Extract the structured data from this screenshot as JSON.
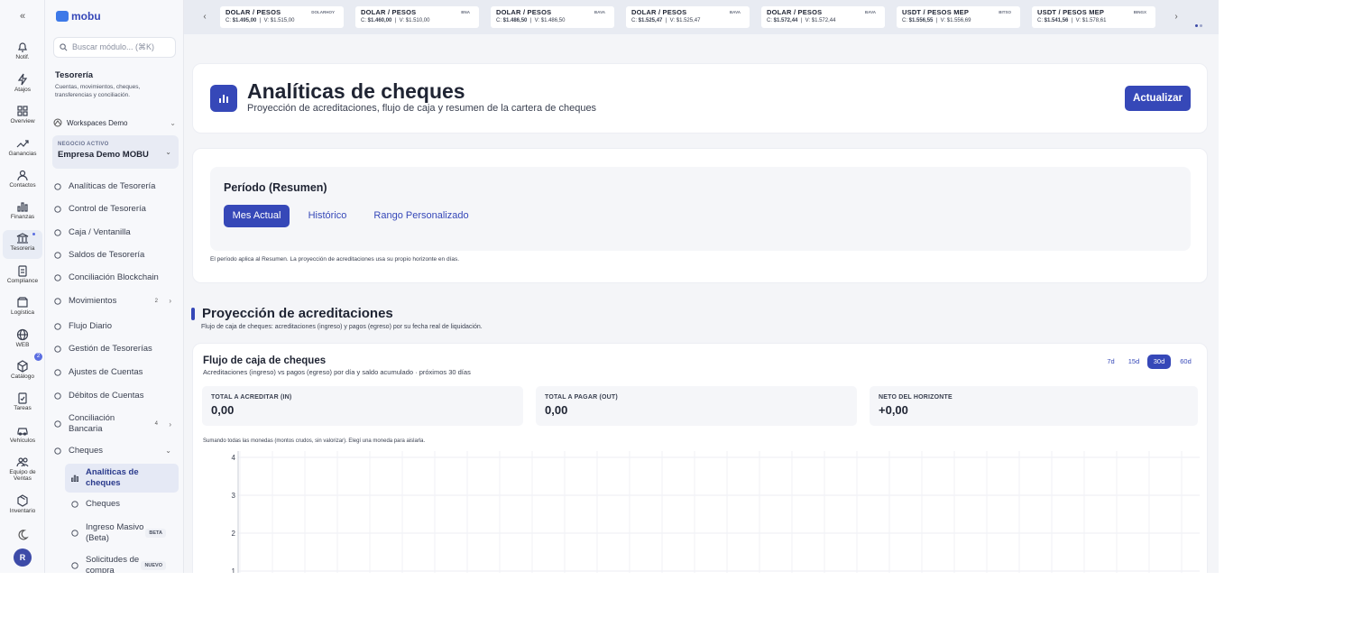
{
  "sidebar_rail": {
    "items": [
      {
        "label": "Notif.",
        "icon": "bell-icon"
      },
      {
        "label": "Atajos",
        "icon": "lightning-icon"
      },
      {
        "label": "Overview",
        "icon": "grid-icon"
      },
      {
        "label": "Ganancias",
        "icon": "trend-up-icon"
      },
      {
        "label": "Contactos",
        "icon": "users-icon"
      },
      {
        "label": "Finanzas",
        "icon": "bar-chart-icon"
      },
      {
        "label": "Tesorería",
        "icon": "bank-icon"
      },
      {
        "label": "Compliance",
        "icon": "clipboard-icon"
      },
      {
        "label": "Logística",
        "icon": "box-icon"
      },
      {
        "label": "WEB",
        "icon": "globe-icon"
      },
      {
        "label": "Catálogo",
        "icon": "cube-icon"
      },
      {
        "label": "Tareas",
        "icon": "clipboard-check-icon"
      },
      {
        "label": "Vehículos",
        "icon": "car-icon"
      },
      {
        "label": "Equipo de Ventas",
        "icon": "team-icon"
      },
      {
        "label": "Inventario",
        "icon": "package-icon"
      }
    ],
    "catalogo_badge": "2",
    "avatar_initial": "R"
  },
  "sidebar": {
    "brand": "mobu",
    "search_placeholder": "Buscar módulo... (⌘K)",
    "section_title": "Tesorería",
    "section_subtitle": "Cuentas, movimientos, cheques, transferencias y conciliación.",
    "workspace": "Workspaces Demo",
    "business_label": "NEGOCIO ACTIVO",
    "business_name": "Empresa Demo MOBU",
    "nav": [
      {
        "label": "Analíticas de Tesorería"
      },
      {
        "label": "Control de Tesorería"
      },
      {
        "label": "Caja / Ventanilla"
      },
      {
        "label": "Saldos de Tesorería"
      },
      {
        "label": "Conciliación Blockchain"
      },
      {
        "label": "Movimientos",
        "badge": "2"
      },
      {
        "label": "Flujo Diario"
      },
      {
        "label": "Gestión de Tesorerías"
      },
      {
        "label": "Ajustes de Cuentas"
      },
      {
        "label": "Débitos de Cuentas"
      },
      {
        "label": "Conciliación Bancaria",
        "badge": "4"
      },
      {
        "label": "Cheques"
      }
    ],
    "sub_nav": [
      {
        "label": "Analíticas de cheques"
      },
      {
        "label": "Cheques"
      },
      {
        "label": "Ingreso Masivo (Beta)",
        "tag": "BETA"
      },
      {
        "label": "Solicitudes de compra",
        "tag": "NUEVO"
      }
    ]
  },
  "ticker": [
    {
      "pair": "DOLAR / PESOS",
      "source": "DOLARHOY",
      "buy": "$1.495,00",
      "sell": "$1.515,00"
    },
    {
      "pair": "DOLAR / PESOS",
      "source": "BNA",
      "buy": "$1.460,00",
      "sell": "$1.510,00"
    },
    {
      "pair": "DOLAR / PESOS",
      "source": "BAVA",
      "buy": "$1.486,50",
      "sell": "$1.486,50"
    },
    {
      "pair": "DOLAR / PESOS",
      "source": "BAVA",
      "buy": "$1.525,47",
      "sell": "$1.525,47"
    },
    {
      "pair": "DOLAR / PESOS",
      "source": "BAVA",
      "buy": "$1.572,44",
      "sell": "$1.572,44"
    },
    {
      "pair": "USDT / PESOS MEP",
      "source": "BITSO",
      "buy": "$1.556,55",
      "sell": "$1.556,69"
    },
    {
      "pair": "USDT / PESOS MEP",
      "source": "BINGX",
      "buy": "$1.541,56",
      "sell": "$1.578,61"
    }
  ],
  "ticker_prefix_buy": "C:",
  "ticker_prefix_sell": "V:",
  "header": {
    "title": "Analíticas de cheques",
    "subtitle": "Proyección de acreditaciones, flujo de caja y resumen de la cartera de cheques",
    "refresh_label": "Actualizar"
  },
  "period": {
    "title": "Período (Resumen)",
    "options": [
      "Mes Actual",
      "Histórico",
      "Rango Personalizado"
    ],
    "selected": "Mes Actual",
    "note": "El período aplica al Resumen. La proyección de acreditaciones usa su propio horizonte en días."
  },
  "projection": {
    "title": "Proyección de acreditaciones",
    "subtitle": "Flujo de caja de cheques: acreditaciones (ingreso) y pagos (egreso) por su fecha real de liquidación."
  },
  "cashflow": {
    "title": "Flujo de caja de cheques",
    "subtitle": "Acreditaciones (ingreso) vs pagos (egreso) por día y saldo acumulado · próximos 30 días",
    "ranges": [
      "7d",
      "15d",
      "30d",
      "60d"
    ],
    "selected_range": "30d",
    "kpis": [
      {
        "label": "TOTAL A ACREDITAR (IN)",
        "value": "0,00"
      },
      {
        "label": "TOTAL A PAGAR (OUT)",
        "value": "0,00"
      },
      {
        "label": "NETO DEL HORIZONTE",
        "value": "+0,00"
      }
    ],
    "note": "Sumando todas las monedas (montos crudos, sin valorizar). Elegí una moneda para aislarla."
  },
  "chart_data": {
    "type": "bar",
    "title": "",
    "xlabel": "",
    "ylabel": "",
    "ylim": [
      0,
      4
    ],
    "yticks": [
      "4",
      "3",
      "2",
      "1"
    ],
    "grid": true,
    "categories": [],
    "series": []
  }
}
